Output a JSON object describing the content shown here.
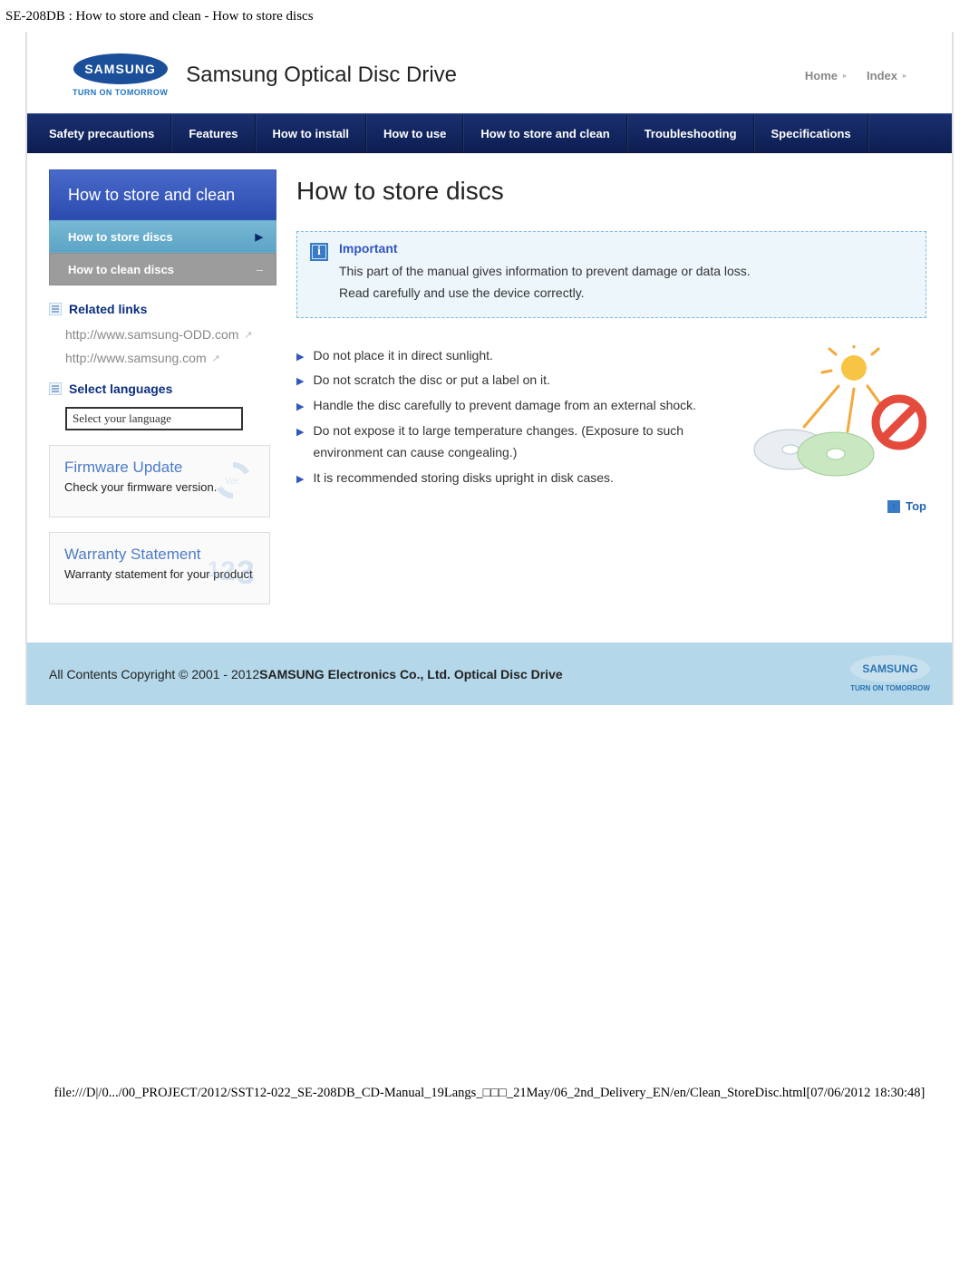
{
  "doc_title": "SE-208DB : How to store and clean - How to store discs",
  "header": {
    "logo_text": "SAMSUNG",
    "logo_tag": "TURN ON TOMORROW",
    "product": "Samsung Optical Disc Drive",
    "links": {
      "home": "Home",
      "index": "Index"
    }
  },
  "nav": [
    "Safety precautions",
    "Features",
    "How to install",
    "How to use",
    "How to store and clean",
    "Troubleshooting",
    "Specifications"
  ],
  "sidebar": {
    "title": "How to store and clean",
    "items": [
      {
        "label": "How to store discs",
        "active": true
      },
      {
        "label": "How to clean discs",
        "active": false
      }
    ],
    "related_head": "Related links",
    "related": [
      "http://www.samsung-ODD.com",
      "http://www.samsung.com"
    ],
    "lang_head": "Select languages",
    "lang_placeholder": "Select your language",
    "fw": {
      "title": "Firmware Update",
      "sub": "Check your firmware version."
    },
    "wr": {
      "title": "Warranty Statement",
      "sub": "Warranty statement for your product"
    }
  },
  "main": {
    "title": "How to store discs",
    "important": {
      "heading": "Important",
      "line1": "This part of the manual gives information to prevent damage or data loss.",
      "line2": "Read carefully and use the device correctly."
    },
    "tips": [
      "Do not place it in direct sunlight.",
      "Do not scratch the disc or put a label on it.",
      "Handle the disc carefully to prevent damage from an external shock.",
      "Do not expose it to large temperature changes. (Exposure to such environment can cause congealing.)",
      "It is recommended storing disks upright in disk cases."
    ],
    "top_label": "Top"
  },
  "footer": {
    "text_prefix": "All Contents Copyright © 2001 - 2012",
    "text_bold": "SAMSUNG Electronics Co., Ltd. Optical Disc Drive",
    "logo": "SAMSUNG",
    "tag": "TURN ON TOMORROW"
  },
  "path": "file:///D|/0.../00_PROJECT/2012/SST12-022_SE-208DB_CD-Manual_19Langs_□□□_21May/06_2nd_Delivery_EN/en/Clean_StoreDisc.html[07/06/2012 18:30:48]"
}
